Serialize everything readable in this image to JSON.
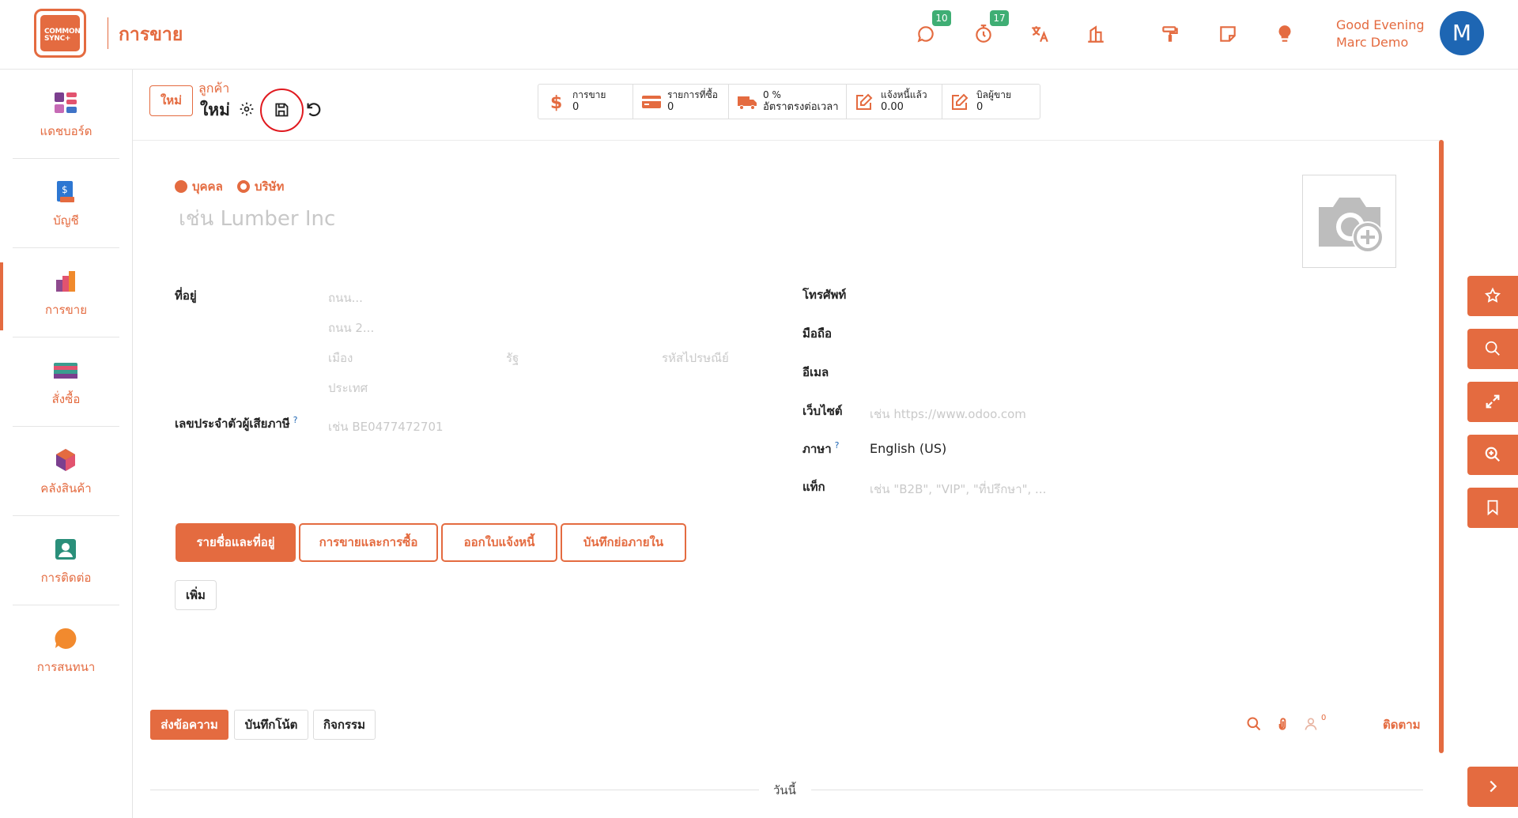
{
  "app": {
    "logo_text": "COMMON SYNC+",
    "title": "การขาย"
  },
  "topbar": {
    "messages_badge": "10",
    "activities_badge": "17",
    "greeting": "Good Evening",
    "user_name": "Marc Demo",
    "avatar_letter": "M"
  },
  "sidebar": {
    "items": [
      {
        "label": "แดชบอร์ด",
        "icon": "dashboard-icon"
      },
      {
        "label": "บัญชี",
        "icon": "invoice-icon"
      },
      {
        "label": "การขาย",
        "icon": "sales-chart-icon"
      },
      {
        "label": "สั่งซื้อ",
        "icon": "card-icon"
      },
      {
        "label": "คลังสินค้า",
        "icon": "box-icon"
      },
      {
        "label": "การติดต่อ",
        "icon": "contact-icon"
      },
      {
        "label": "การสนทนา",
        "icon": "chat-bubble-icon"
      }
    ],
    "active_index": 2
  },
  "control": {
    "new_label": "ใหม่",
    "breadcrumb_parent": "ลูกค้า",
    "breadcrumb_current": "ใหม่"
  },
  "stats": [
    {
      "label": "การขาย",
      "value": "0",
      "icon": "dollar-icon"
    },
    {
      "label": "รายการที่ซื้อ",
      "value": "0",
      "icon": "credit-card-icon"
    },
    {
      "label": "0 %",
      "value": "อัตราตรงต่อเวลา",
      "icon": "truck-icon"
    },
    {
      "label": "แจ้งหนี้แล้ว",
      "value": "0.00",
      "icon": "edit-icon"
    },
    {
      "label": "บิลผู้ขาย",
      "value": "0",
      "icon": "edit-icon"
    }
  ],
  "form": {
    "radio_person": "บุคคล",
    "radio_company": "บริษัท",
    "name_placeholder": "เช่น Lumber Inc",
    "address_label": "ที่อยู่",
    "street_ph": "ถนน...",
    "street2_ph": "ถนน 2...",
    "city_ph": "เมือง",
    "state_ph": "รัฐ",
    "zip_ph": "รหัสไปรษณีย์",
    "country_ph": "ประเทศ",
    "vat_label": "เลขประจำตัวผู้เสียภาษี",
    "vat_help": "?",
    "vat_ph": "เช่น BE0477472701",
    "phone_label": "โทรศัพท์",
    "mobile_label": "มือถือ",
    "email_label": "อีเมล",
    "website_label": "เว็บไซต์",
    "website_ph": "เช่น https://www.odoo.com",
    "lang_label": "ภาษา",
    "lang_help": "?",
    "lang_value": "English (US)",
    "tags_label": "แท็ก",
    "tags_ph": "เช่น \"B2B\", \"VIP\", \"ที่ปรึกษา\", ..."
  },
  "tabs": [
    {
      "label": "รายชื่อและที่อยู่",
      "active": true
    },
    {
      "label": "การขายและการซื้อ",
      "active": false
    },
    {
      "label": "ออกใบแจ้งหนี้",
      "active": false
    },
    {
      "label": "บันทึกย่อภายใน",
      "active": false
    }
  ],
  "add_label": "เพิ่ม",
  "chatter": {
    "send_message": "ส่งข้อความ",
    "log_note": "บันทึกโน้ต",
    "activity": "กิจกรรม",
    "followers_count": "0",
    "follow": "ติดตาม",
    "today": "วันนี้"
  },
  "colors": {
    "accent": "#e46b40",
    "badge": "#3fae74",
    "avatar": "#1e66b3",
    "save_highlight": "#e0191f"
  }
}
